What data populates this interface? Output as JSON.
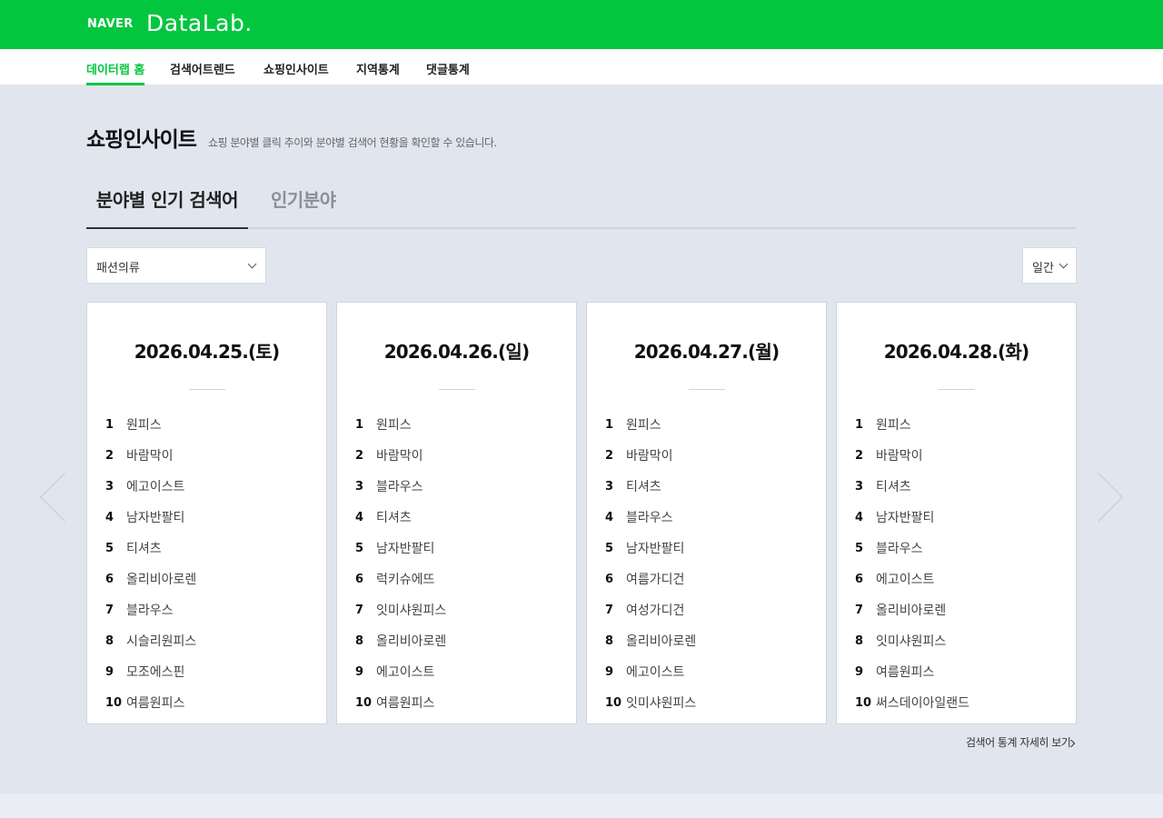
{
  "header": {
    "brand": "NAVER",
    "product": "DataLab."
  },
  "nav": [
    {
      "label": "데이터랩 홈",
      "active": true
    },
    {
      "label": "검색어트렌드",
      "active": false
    },
    {
      "label": "쇼핑인사이트",
      "active": false
    },
    {
      "label": "지역통계",
      "active": false
    },
    {
      "label": "댓글통계",
      "active": false
    }
  ],
  "page": {
    "title": "쇼핑인사이트",
    "description": "쇼핑 분야별 클릭 추이와 분야별 검색어 현황을 확인할 수 있습니다."
  },
  "tabs": [
    {
      "label": "분야별 인기 검색어",
      "active": true
    },
    {
      "label": "인기분야",
      "active": false
    }
  ],
  "filters": {
    "category": "패션의류",
    "period": "일간"
  },
  "cards": [
    {
      "date": "2026.04.25.(토)",
      "keywords": [
        "원피스",
        "바람막이",
        "에고이스트",
        "남자반팔티",
        "티셔츠",
        "올리비아로렌",
        "블라우스",
        "시슬리원피스",
        "모조에스핀",
        "여름원피스"
      ]
    },
    {
      "date": "2026.04.26.(일)",
      "keywords": [
        "원피스",
        "바람막이",
        "블라우스",
        "티셔츠",
        "남자반팔티",
        "럭키슈에뜨",
        "잇미샤원피스",
        "올리비아로렌",
        "에고이스트",
        "여름원피스"
      ]
    },
    {
      "date": "2026.04.27.(월)",
      "keywords": [
        "원피스",
        "바람막이",
        "티셔츠",
        "블라우스",
        "남자반팔티",
        "여름가디건",
        "여성가디건",
        "올리비아로렌",
        "에고이스트",
        "잇미샤원피스"
      ]
    },
    {
      "date": "2026.04.28.(화)",
      "keywords": [
        "원피스",
        "바람막이",
        "티셔츠",
        "남자반팔티",
        "블라우스",
        "에고이스트",
        "올리비아로렌",
        "잇미샤원피스",
        "여름원피스",
        "써스데이아일랜드"
      ]
    }
  ],
  "rank_numbers": [
    "1",
    "2",
    "3",
    "4",
    "5",
    "6",
    "7",
    "8",
    "9",
    "10"
  ],
  "more_link": "검색어 통계 자세히 보기",
  "colors": {
    "brand_green": "#03c63f",
    "background": "#e1e6ee"
  },
  "icons": {
    "prev": "chevron-left-icon",
    "next": "chevron-right-icon",
    "dropdown": "chevron-down-icon"
  }
}
